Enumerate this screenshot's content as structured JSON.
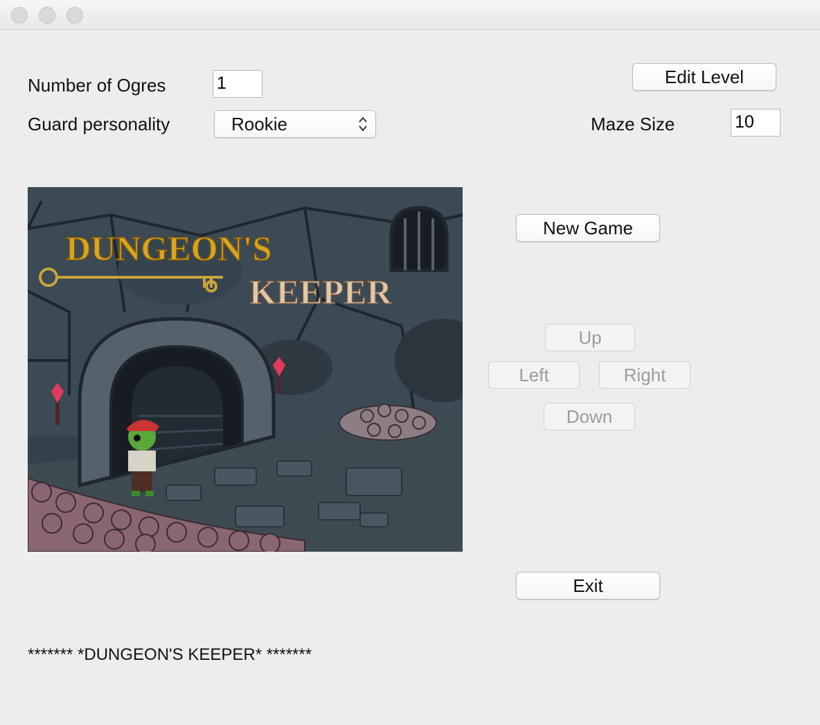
{
  "window": {
    "traffic_lights": [
      "close",
      "minimize",
      "zoom"
    ]
  },
  "settings": {
    "ogres_label": "Number of Ogres",
    "ogres_value": "1",
    "guard_label": "Guard personality",
    "guard_selected": "Rookie",
    "maze_label": "Maze Size",
    "maze_value": "10"
  },
  "buttons": {
    "edit_level": "Edit Level",
    "new_game": "New Game",
    "exit": "Exit"
  },
  "movement": {
    "up": "Up",
    "left": "Left",
    "right": "Right",
    "down": "Down",
    "enabled": false
  },
  "art": {
    "title_line1": "DUNGEON'S",
    "title_line2": "KEEPER"
  },
  "status_text": "******* *DUNGEON'S KEEPER* *******",
  "colors": {
    "background": "#ededed",
    "disabled_text": "#9c9c9c",
    "title_gold": "#d8a521",
    "title_tan": "#e2c8a8"
  }
}
